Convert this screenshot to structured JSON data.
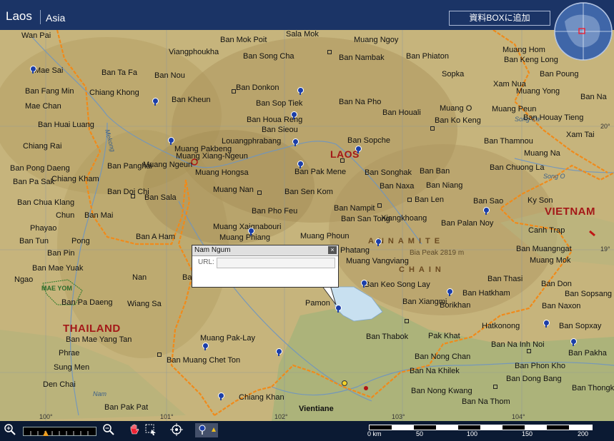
{
  "header": {
    "title": "Laos",
    "subtitle": "Asia",
    "add_button": "資料BOXに追加"
  },
  "countries": {
    "laos": "LAOS",
    "thailand": "THAILAND",
    "vietnam": "VIETNAM"
  },
  "regions": {
    "annamite": "ANNAMITE",
    "chain": "CHAIN"
  },
  "park": "MAE YOM",
  "peak": "Bia Peak 2819 m",
  "rivers": [
    "Mekong",
    "Nam",
    "Song Ca",
    "Song O"
  ],
  "places": [
    "Wan Pai",
    "Sala Mok",
    "Muang Ngoy",
    "Ban Mok Poit",
    "Viangphoukha",
    "Ban Song Cha",
    "Ban Nambak",
    "Ban Phiaton",
    "Muang Hom",
    "Ban Keng Long",
    "Mae Sai",
    "Ban Ta Fa",
    "Ban Nou",
    "Sopka",
    "Ban Poung",
    "Ban Fang Min",
    "Chiang Khong",
    "Ban Donkon",
    "Xam Nua",
    "Muang Yong",
    "Ban Na",
    "Mae Chan",
    "Ban Kheun",
    "Ban Sop Tiek",
    "Ban Na Pho",
    "Ban Houali",
    "Muang O",
    "Muang Peun",
    "Ban Huai Luang",
    "Ban Houa Reng",
    "Ban Sieou",
    "Ban Ko Keng",
    "Ban Houay Tieng",
    "Chiang Rai",
    "Louangphrabang",
    "Ban Sopche",
    "Ban Thamnou",
    "Xam Tai",
    "Muang Pakbeng",
    "Muang Xiang-Ngeun",
    "Muang Na",
    "Ban Panghai",
    "Muang Ngeun",
    "Ban Pak Mene",
    "Ban Songhak",
    "Ban Ban",
    "Ban Chuong La",
    "Ban Pong Daeng",
    "Chiang Kham",
    "Muang Hongsa",
    "Ban Naxa",
    "Ban Niang",
    "Ban Pa Sak",
    "Ban Doi Chi",
    "Ban Sala",
    "Muang Nan",
    "Ban Sen Kom",
    "Ban Len",
    "Ky Son",
    "Ban Chua Klang",
    "Ban Mai",
    "Chun",
    "Ban Pho Feu",
    "Ban Nampit",
    "Ban Sao",
    "Phayao",
    "Muang Xaignabouri",
    "Ban San Tong",
    "Xiangkhoang",
    "Ban Palan Noy",
    "Canh Trap",
    "Ban Tun",
    "Ban A Ham",
    "Muang Phiang",
    "Muang Phoun",
    "Pong",
    "Ban Pin",
    "Phatang",
    "Ban Muangngat",
    "Ban Mae Yuak",
    "Ngao",
    "Nan",
    "Ban Tom",
    "Muang Mok",
    "Ban Keo Song Lay",
    "Ban Thasi",
    "Ban Don",
    "Ban Sopsang",
    "Ban Pa Daeng",
    "Wiang Sa",
    "Ban Hatkham",
    "Borikhan",
    "Ban Xiangmi",
    "Ban Naxon",
    "Pamon",
    "Hatkonong",
    "Ban Sopxay",
    "Ban Mae Yang Tan",
    "Ban Thabok",
    "Pak Khat",
    "Muang Pak-Lay",
    "Ban Na Inh Noi",
    "Phrae",
    "Ban Pakha",
    "Ban Nong Chan",
    "Ban Muang Chet Ton",
    "Ban Phon Kho",
    "Sung Men",
    "Ban Na Khilek",
    "Ban Dong Bang",
    "Den Chai",
    "Chiang Khan",
    "Vientiane",
    "Ban Thongkha",
    "Ban Nong Kwang",
    "Ban Na Thom",
    "Ban Pak Pat",
    "Muang Vangviang"
  ],
  "longitudes": [
    "100°",
    "101°",
    "102°",
    "103°",
    "104°"
  ],
  "latitudes": [
    "20°",
    "19°"
  ],
  "popup": {
    "title": "Nam Ngum",
    "url_label": "URL:",
    "url_value": "",
    "close": "×"
  },
  "scale": {
    "labels": [
      "0 km",
      "50",
      "100",
      "150",
      "200"
    ]
  },
  "colors": {
    "header_bg": "#1b3466",
    "border": "#f08a1a",
    "country_label": "#a31818",
    "water": "#c8e0f0"
  },
  "toolbar": {
    "zoom_in": "zoom-in-icon",
    "zoom_out": "zoom-out-icon",
    "pan": "hand-icon",
    "select": "select-icon",
    "center": "target-icon",
    "pin": "pin-icon"
  }
}
